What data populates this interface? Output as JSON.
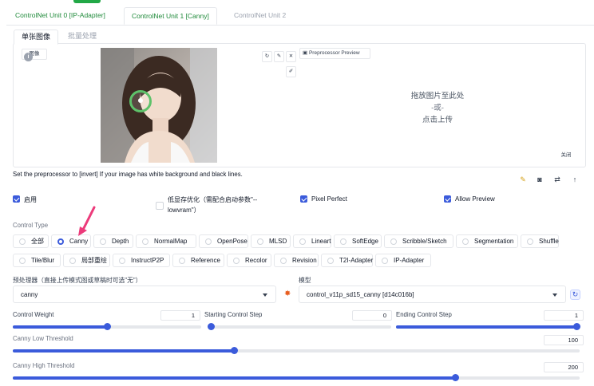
{
  "unit_tabs": [
    {
      "label": "ControlNet Unit 0 [IP-Adapter]"
    },
    {
      "label": "ControlNet Unit 1 [Canny]"
    },
    {
      "label": "ControlNet Unit 2"
    }
  ],
  "image_tabs": [
    {
      "label": "单张图像"
    },
    {
      "label": "批量处理"
    }
  ],
  "image_panel": {
    "image_chip_label": "图像",
    "preprocessor_preview_label": "Preprocessor Preview",
    "drop_line1": "拖放图片至此处",
    "drop_line2": "-或-",
    "drop_line3": "点击上传",
    "close_label": "关闭"
  },
  "hint_text": "Set the preprocessor to [invert] If your image has white background and black lines.",
  "checkboxes": {
    "enable": {
      "label": "启用",
      "checked": true
    },
    "lowvram": {
      "label_line1": "低显存优化（需配合启动参数\"--",
      "label_line2": "lowvram\"）",
      "checked": false
    },
    "pixel_perfect": {
      "label": "Pixel Perfect",
      "checked": true
    },
    "allow_preview": {
      "label": "Allow Preview",
      "checked": true
    }
  },
  "control_type": {
    "label": "Control Type",
    "selected": "Canny",
    "row1": [
      "全部",
      "Canny",
      "Depth",
      "NormalMap",
      "OpenPose",
      "MLSD",
      "Lineart",
      "SoftEdge",
      "Scribble/Sketch",
      "Segmentation",
      "Shuffle"
    ],
    "row2": [
      "Tile/Blur",
      "局部重绘",
      "InstructP2P",
      "Reference",
      "Recolor",
      "Revision",
      "T2I-Adapter",
      "IP-Adapter"
    ]
  },
  "preprocessor": {
    "label": "预处理器（直接上传模式图或草稿时可选\"无\"）",
    "value": "canny"
  },
  "model": {
    "label": "模型",
    "value": "control_v11p_sd15_canny [d14c016b]"
  },
  "sliders": {
    "control_weight": {
      "label": "Control Weight",
      "value": "1",
      "fraction": 0.5
    },
    "starting_step": {
      "label": "Starting Control Step",
      "value": "0",
      "fraction": 0.0
    },
    "ending_step": {
      "label": "Ending Control Step",
      "value": "1",
      "fraction": 1.0
    },
    "canny_low": {
      "label": "Canny Low Threshold",
      "value": "100",
      "fraction": 0.39
    },
    "canny_high": {
      "label": "Canny High Threshold",
      "value": "200",
      "fraction": 0.78
    }
  },
  "colors": {
    "accent_blue": "#3b5bdb",
    "accent_green": "#22a846",
    "annotation_arrow": "#ec3a7a"
  }
}
